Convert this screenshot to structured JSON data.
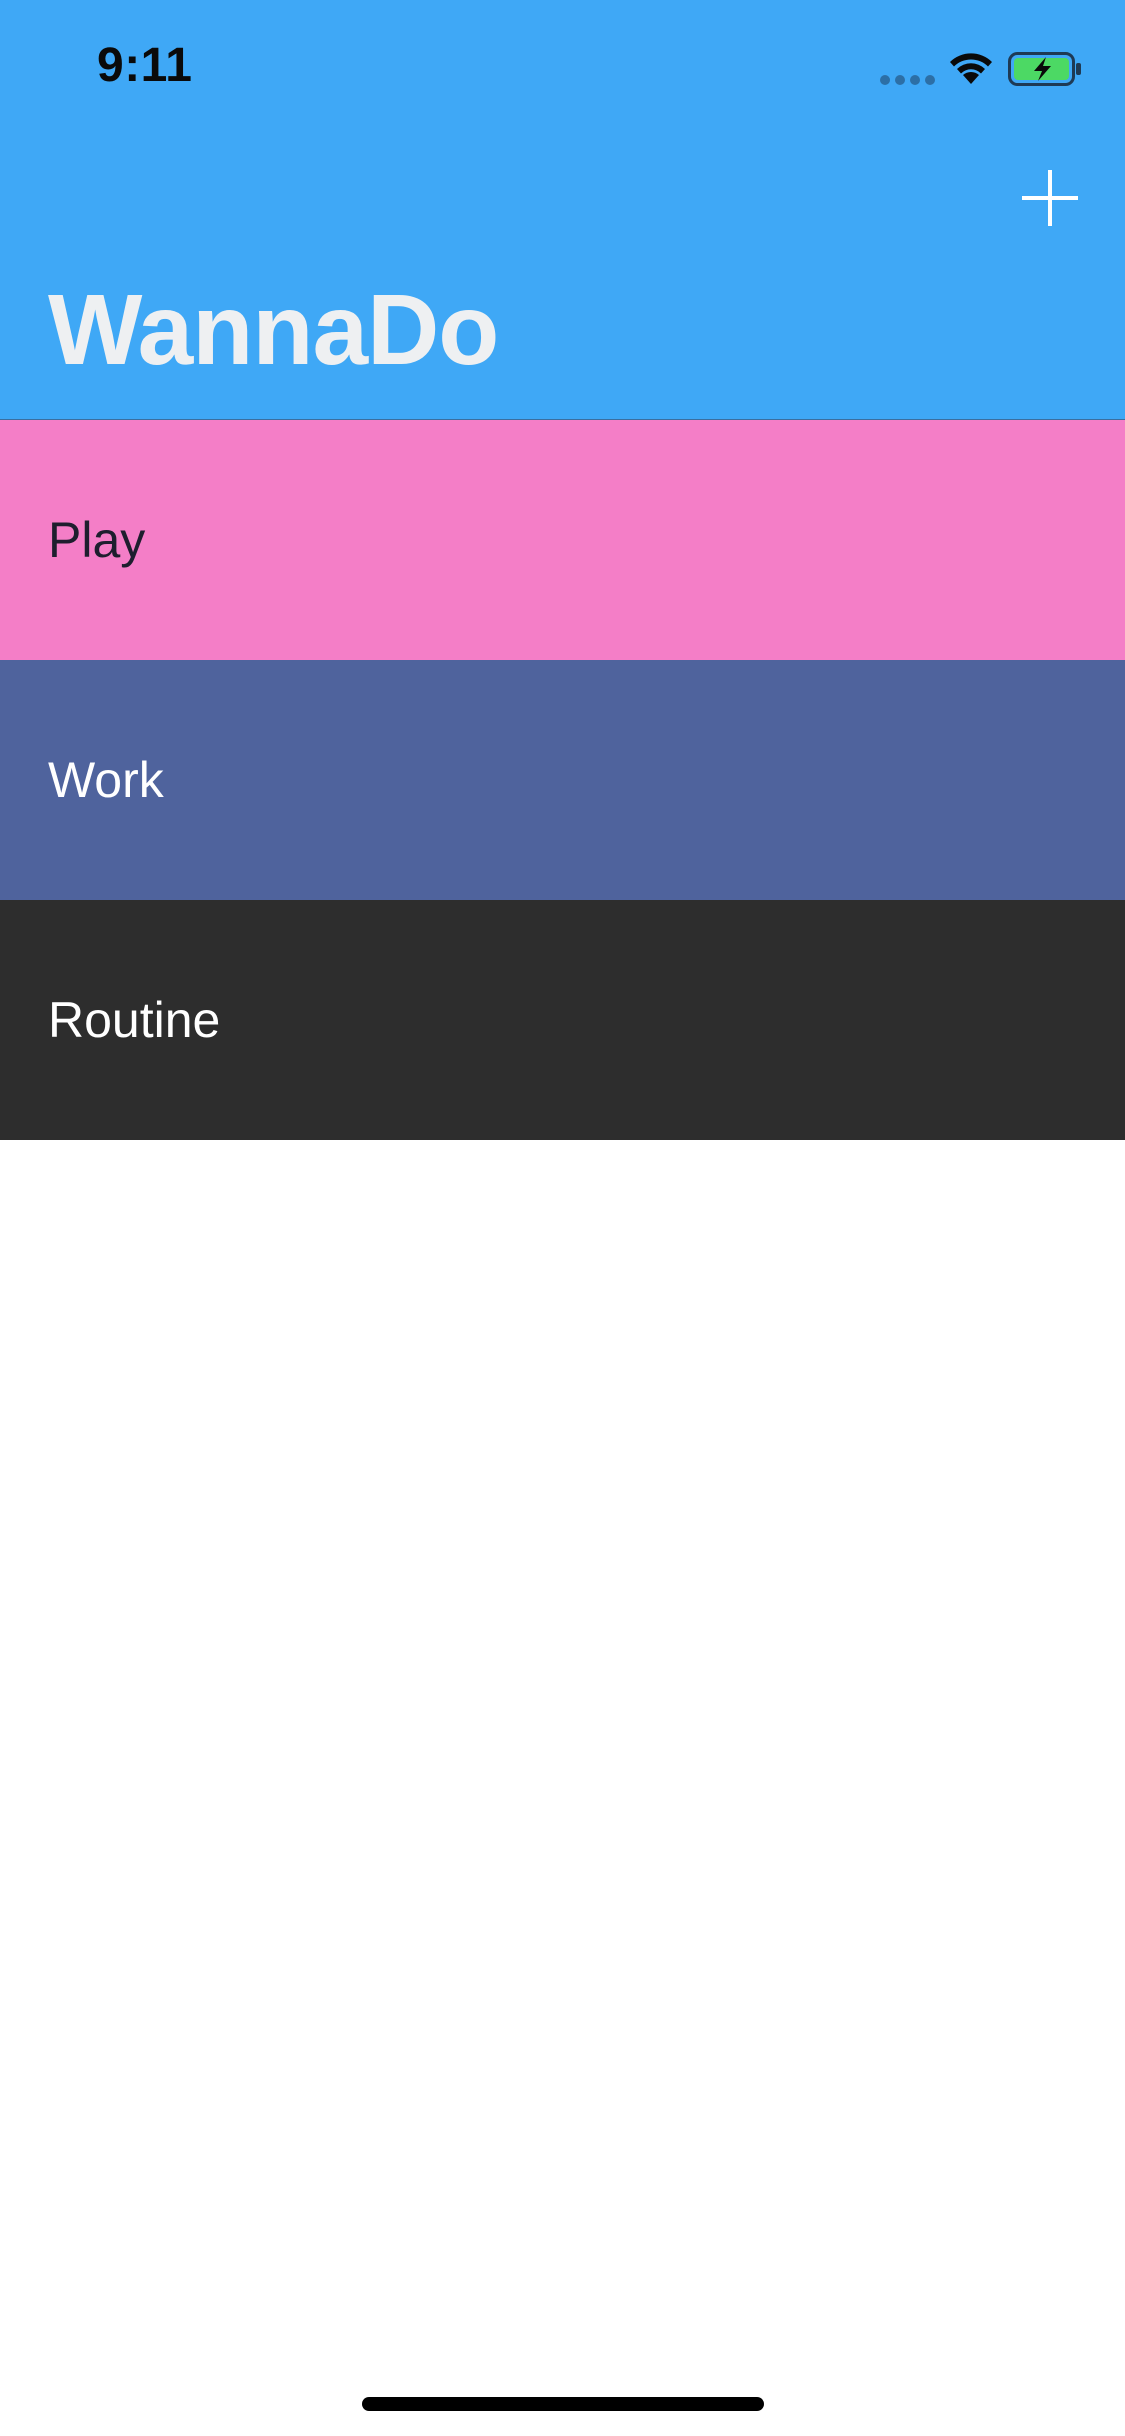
{
  "status_bar": {
    "time": "9:11",
    "icons": [
      "cellular-signal-icon",
      "wifi-icon",
      "battery-charging-icon"
    ]
  },
  "nav": {
    "title": "WannaDo",
    "add_icon": "plus-icon",
    "background_color": "#3FA8F6",
    "title_color": "#EEF0F2"
  },
  "categories": [
    {
      "label": "Play",
      "background_color": "#F47EC7",
      "text_color": "#1E1E2E"
    },
    {
      "label": "Work",
      "background_color": "#4F639D",
      "text_color": "#FFFFFF"
    },
    {
      "label": "Routine",
      "background_color": "#2D2D2D",
      "text_color": "#FFFFFF"
    }
  ],
  "colors": {
    "battery_fill": "#4CD964",
    "page_background": "#FFFFFF"
  }
}
